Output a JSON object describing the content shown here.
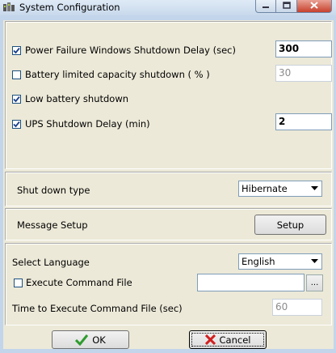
{
  "window": {
    "title": "System Configuration"
  },
  "power": {
    "power_failure": {
      "label": "Power Failure Windows Shutdown Delay (sec)",
      "checked": true,
      "value": "300"
    },
    "battery_limited": {
      "label": "Battery limited  capacity shutdown ( % )",
      "checked": false,
      "value": "30"
    },
    "low_battery": {
      "label": "Low battery shutdown",
      "checked": true
    },
    "ups_delay": {
      "label": "UPS Shutdown Delay (min)",
      "checked": true,
      "value": "2"
    }
  },
  "shutdown": {
    "label": "Shut down type",
    "selected": "Hibernate"
  },
  "message": {
    "label": "Message Setup",
    "button": "Setup"
  },
  "language": {
    "label": "Select Language",
    "selected": "English"
  },
  "command": {
    "execute_label": "Execute Command File",
    "checked": false,
    "path_value": "",
    "browse_label": "...",
    "time_label": "Time to Execute Command File (sec)",
    "time_value": "60"
  },
  "footer": {
    "ok_label": "OK",
    "cancel_label": "Cancel"
  },
  "colors": {
    "check": "#1a3f8a",
    "ok_icon": "#2e9b2e",
    "cancel_icon": "#d22020"
  },
  "icons": [
    "app-icon",
    "minimize-icon",
    "maximize-icon",
    "close-icon",
    "checkmark-icon",
    "chevron-down-icon",
    "ok-check-icon",
    "cancel-x-icon"
  ]
}
